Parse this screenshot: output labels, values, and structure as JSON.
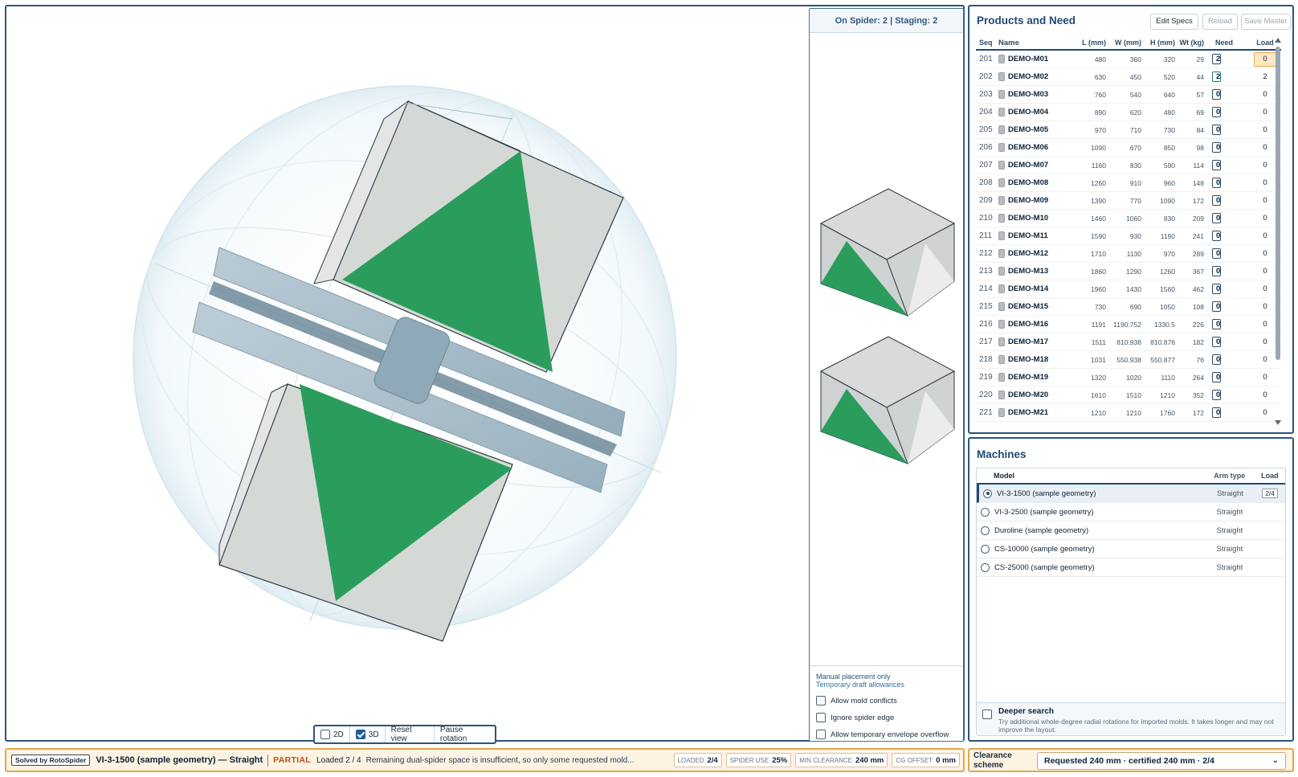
{
  "staging": {
    "header": "On Spider: 2 | Staging: 2",
    "note1": "Manual placement only",
    "note2": "Temporary draft allowances",
    "options": [
      "Allow mold conflicts",
      "Ignore spider edge",
      "Allow temporary envelope overflow"
    ]
  },
  "viewctl": {
    "btn_2d": "2D",
    "btn_3d": "3D",
    "reset": "Reset view",
    "pause": "Pause rotation"
  },
  "products": {
    "title": "Products and Need",
    "edit": "Edit Specs",
    "reload": "Reload",
    "save": "Save Master",
    "columns": {
      "seq": "Seq",
      "name": "Name",
      "l": "L (mm)",
      "w": "W (mm)",
      "h": "H (mm)",
      "wt": "Wt (kg)",
      "need": "Need",
      "load": "Load"
    },
    "rows": [
      {
        "seq": "201",
        "name": "DEMO-M01",
        "l": "480",
        "w": "360",
        "h": "320",
        "wt": "29",
        "need": "2",
        "load": "0"
      },
      {
        "seq": "202",
        "name": "DEMO-M02",
        "l": "630",
        "w": "450",
        "h": "520",
        "wt": "44",
        "need": "2",
        "load": "2"
      },
      {
        "seq": "203",
        "name": "DEMO-M03",
        "l": "760",
        "w": "540",
        "h": "640",
        "wt": "57",
        "need": "0",
        "load": "0"
      },
      {
        "seq": "204",
        "name": "DEMO-M04",
        "l": "890",
        "w": "620",
        "h": "480",
        "wt": "69",
        "need": "0",
        "load": "0"
      },
      {
        "seq": "205",
        "name": "DEMO-M05",
        "l": "970",
        "w": "710",
        "h": "730",
        "wt": "84",
        "need": "0",
        "load": "0"
      },
      {
        "seq": "206",
        "name": "DEMO-M06",
        "l": "1090",
        "w": "670",
        "h": "850",
        "wt": "98",
        "need": "0",
        "load": "0"
      },
      {
        "seq": "207",
        "name": "DEMO-M07",
        "l": "1160",
        "w": "830",
        "h": "590",
        "wt": "114",
        "need": "0",
        "load": "0"
      },
      {
        "seq": "208",
        "name": "DEMO-M08",
        "l": "1260",
        "w": "910",
        "h": "960",
        "wt": "148",
        "need": "0",
        "load": "0"
      },
      {
        "seq": "209",
        "name": "DEMO-M09",
        "l": "1390",
        "w": "770",
        "h": "1090",
        "wt": "172",
        "need": "0",
        "load": "0"
      },
      {
        "seq": "210",
        "name": "DEMO-M10",
        "l": "1460",
        "w": "1060",
        "h": "830",
        "wt": "209",
        "need": "0",
        "load": "0"
      },
      {
        "seq": "211",
        "name": "DEMO-M11",
        "l": "1590",
        "w": "930",
        "h": "1190",
        "wt": "241",
        "need": "0",
        "load": "0"
      },
      {
        "seq": "212",
        "name": "DEMO-M12",
        "l": "1710",
        "w": "1130",
        "h": "970",
        "wt": "289",
        "need": "0",
        "load": "0"
      },
      {
        "seq": "213",
        "name": "DEMO-M13",
        "l": "1860",
        "w": "1290",
        "h": "1260",
        "wt": "367",
        "need": "0",
        "load": "0"
      },
      {
        "seq": "214",
        "name": "DEMO-M14",
        "l": "1960",
        "w": "1430",
        "h": "1560",
        "wt": "462",
        "need": "0",
        "load": "0"
      },
      {
        "seq": "215",
        "name": "DEMO-M15",
        "l": "730",
        "w": "690",
        "h": "1050",
        "wt": "108",
        "need": "0",
        "load": "0"
      },
      {
        "seq": "216",
        "name": "DEMO-M16",
        "l": "1191",
        "w": "1190.752",
        "h": "1330.5",
        "wt": "226",
        "need": "0",
        "load": "0"
      },
      {
        "seq": "217",
        "name": "DEMO-M17",
        "l": "1511",
        "w": "810.938",
        "h": "810.876",
        "wt": "182",
        "need": "0",
        "load": "0"
      },
      {
        "seq": "218",
        "name": "DEMO-M18",
        "l": "1031",
        "w": "550.938",
        "h": "550.877",
        "wt": "76",
        "need": "0",
        "load": "0"
      },
      {
        "seq": "219",
        "name": "DEMO-M19",
        "l": "1320",
        "w": "1020",
        "h": "1110",
        "wt": "264",
        "need": "0",
        "load": "0"
      },
      {
        "seq": "220",
        "name": "DEMO-M20",
        "l": "1610",
        "w": "1510",
        "h": "1210",
        "wt": "352",
        "need": "0",
        "load": "0"
      },
      {
        "seq": "221",
        "name": "DEMO-M21",
        "l": "1210",
        "w": "1210",
        "h": "1760",
        "wt": "172",
        "need": "0",
        "load": "0"
      }
    ]
  },
  "machines": {
    "title": "Machines",
    "columns": {
      "model": "Model",
      "arm": "Arm type",
      "load": "Load"
    },
    "rows": [
      {
        "model": "VI-3-1500 (sample geometry)",
        "arm": "Straight",
        "load": "2/4"
      },
      {
        "model": "VI-3-2500 (sample geometry)",
        "arm": "Straight",
        "load": ""
      },
      {
        "model": "Duroline (sample geometry)",
        "arm": "Straight",
        "load": ""
      },
      {
        "model": "CS-10000 (sample geometry)",
        "arm": "Straight",
        "load": ""
      },
      {
        "model": "CS-25000 (sample geometry)",
        "arm": "Straight",
        "load": ""
      }
    ],
    "deeper_label": "Deeper search",
    "deeper_desc": "Try additional whole-degree radial rotations for imported molds. It takes longer and may not improve the layout."
  },
  "status": {
    "solved": "Solved by RotoSpider",
    "machine": "VI-3-1500 (sample geometry) — Straight",
    "state": "PARTIAL",
    "loaded": "Loaded 2 / 4",
    "message": "Remaining dual-spider space is insufficient, so only some requested mold...",
    "chips": [
      {
        "label": "LOADED",
        "value": "2/4"
      },
      {
        "label": "SPIDER USE",
        "value": "25%"
      },
      {
        "label": "MIN CLEARANCE",
        "value": "240 mm"
      },
      {
        "label": "CG OFFSET",
        "value": "0 mm"
      }
    ]
  },
  "clearance": {
    "label": "Clearance scheme",
    "value": "Requested 240 mm · certified 240 mm · 2/4"
  },
  "colors": {
    "accent": "#1f4a72",
    "mold_green": "#2a9d5c",
    "warning": "#e4a54a"
  }
}
